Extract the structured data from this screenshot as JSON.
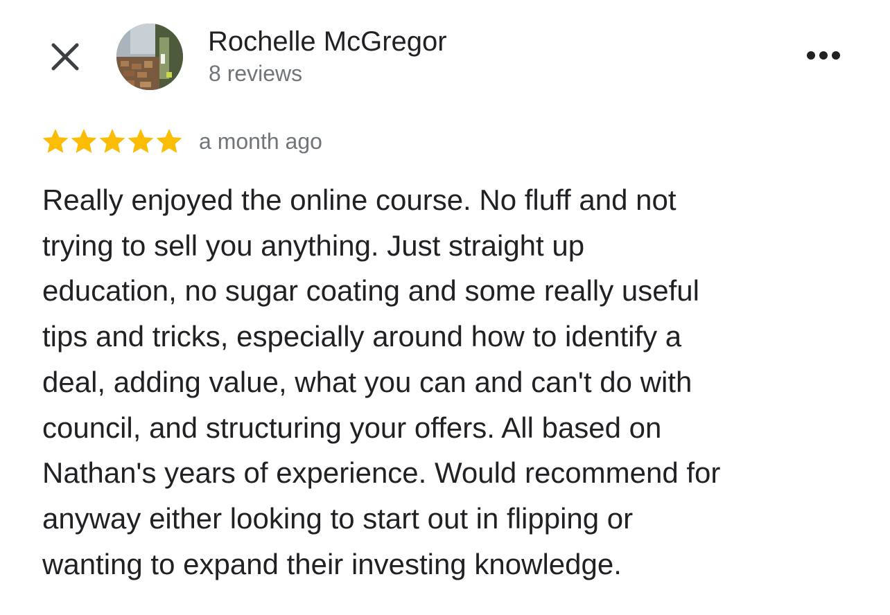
{
  "header": {
    "close_icon": "close-icon",
    "author": {
      "name": "Rochelle McGregor",
      "reviews": "8 reviews",
      "avatar": "avatar-photo"
    },
    "more_icon": "more-horizontal-icon"
  },
  "review": {
    "rating": 5,
    "rating_max": 5,
    "star_color": "#fbbc04",
    "time": "a month ago",
    "text_lines": [
      "Really enjoyed the online course. No fluff and not",
      "trying to sell you anything. Just straight up",
      "education, no sugar coating and some really useful",
      "tips and tricks, especially around how to identify a",
      "deal, adding value, what you can and can't do with",
      "council, and structuring your offers. All based on",
      "Nathan's years of experience. Would recommend for",
      "anyway either looking to start out in flipping or",
      "wanting to expand their investing knowledge."
    ]
  },
  "colors": {
    "text_primary": "#202124",
    "text_secondary": "#70757a",
    "background": "#ffffff"
  }
}
